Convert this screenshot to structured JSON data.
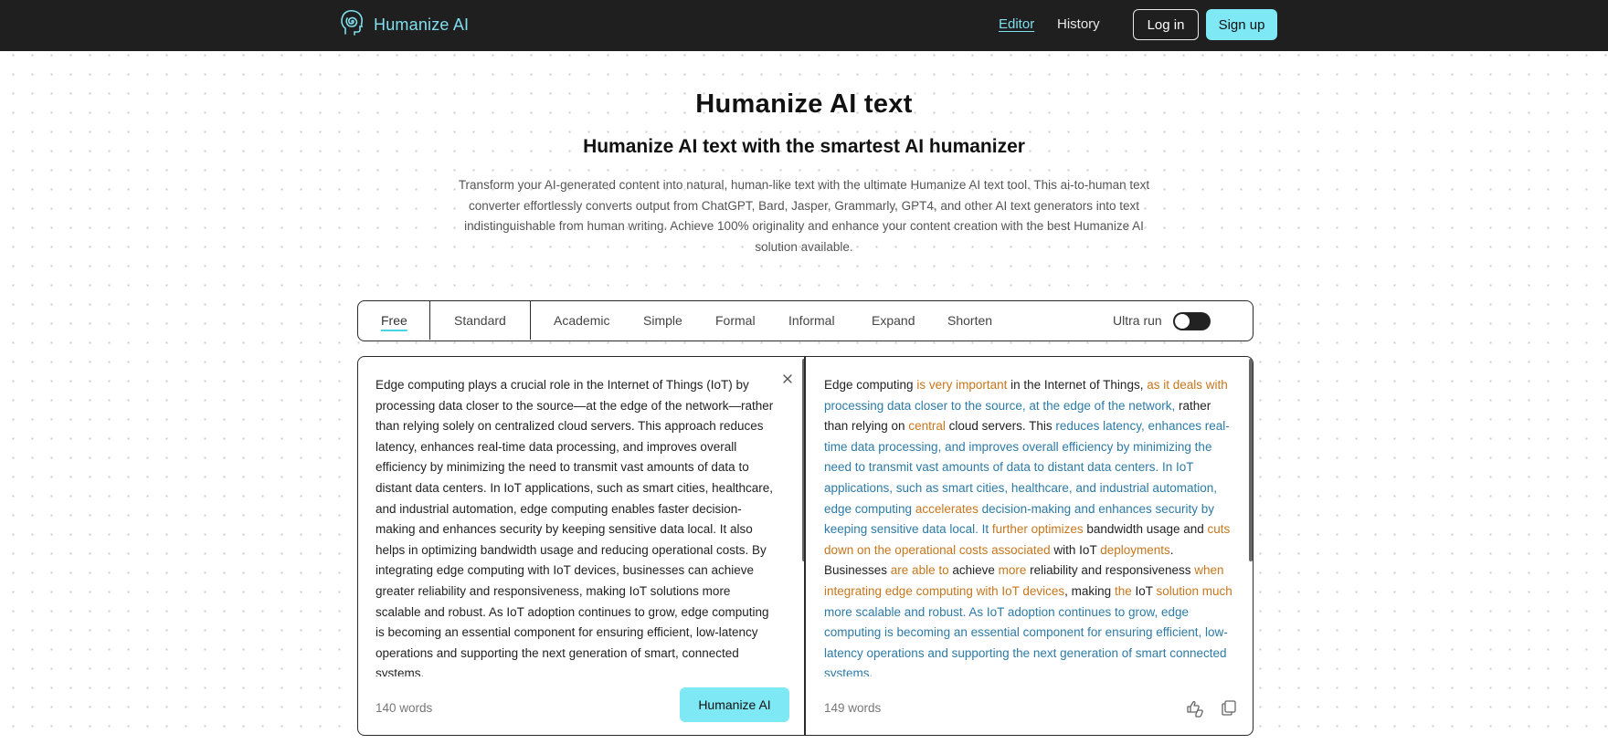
{
  "header": {
    "brand_name": "Humanize AI",
    "logo_icon": "head-spiral-icon",
    "nav": {
      "editor": "Editor",
      "history": "History"
    },
    "login_label": "Log in",
    "signup_label": "Sign up"
  },
  "hero": {
    "title": "Humanize AI text",
    "subtitle": "Humanize AI text with the smartest AI humanizer",
    "description": "Transform your AI-generated content into natural, human-like text with the ultimate Humanize AI text tool. This ai-to-human text converter effortlessly converts output from ChatGPT, Bard, Jasper, Grammarly, GPT4, and other AI text generators into text indistinguishable from human writing. Achieve 100% originality and enhance your content creation with the best Humanize AI solution available."
  },
  "modes": {
    "items": [
      "Free",
      "Standard",
      "Academic",
      "Simple",
      "Formal",
      "Informal",
      "Expand",
      "Shorten"
    ],
    "active": "Free",
    "ultra_label": "Ultra run",
    "ultra_on": false
  },
  "input": {
    "text": "Edge computing plays a crucial role in the Internet of Things (IoT) by processing data closer to the source—at the edge of the network—rather than relying solely on centralized cloud servers. This approach reduces latency, enhances real-time data processing, and improves overall efficiency by minimizing the need to transmit vast amounts of data to distant data centers. In IoT applications, such as smart cities, healthcare, and industrial automation, edge computing enables faster decision-making and enhances security by keeping sensitive data local. It also helps in optimizing bandwidth usage and reducing operational costs. By integrating edge computing with IoT devices, businesses can achieve greater reliability and responsiveness, making IoT solutions more scalable and robust. As IoT adoption continues to grow, edge computing is becoming an essential component for ensuring efficient, low-latency operations and supporting the next generation of smart, connected systems.",
    "word_count": "140 words",
    "humanize_label": "Humanize AI"
  },
  "output": {
    "segments": [
      {
        "t": "Edge computing ",
        "k": "plain"
      },
      {
        "t": "is very important",
        "k": "changed"
      },
      {
        "t": " in the Internet of Things, ",
        "k": "plain"
      },
      {
        "t": "as it deals with",
        "k": "changed"
      },
      {
        "t": " processing data closer to the source, at the edge of the network,",
        "k": "kept"
      },
      {
        "t": " rather than relying on ",
        "k": "plain"
      },
      {
        "t": "central",
        "k": "changed"
      },
      {
        "t": " cloud servers. This ",
        "k": "plain"
      },
      {
        "t": "reduces latency, enhances real-time data processing, and improves overall efficiency by minimizing the need to transmit vast amounts of data to distant data centers. In IoT applications, such as smart cities, healthcare, and industrial automation, edge computing",
        "k": "kept"
      },
      {
        "t": " accelerates",
        "k": "changed"
      },
      {
        "t": " decision-making and enhances security by keeping sensitive data local. It",
        "k": "kept"
      },
      {
        "t": " further optimizes",
        "k": "changed"
      },
      {
        "t": " bandwidth usage and ",
        "k": "plain"
      },
      {
        "t": "cuts down on the operational costs associated",
        "k": "changed"
      },
      {
        "t": " with IoT ",
        "k": "plain"
      },
      {
        "t": "deployments",
        "k": "changed"
      },
      {
        "t": ". Businesses ",
        "k": "plain"
      },
      {
        "t": "are able to",
        "k": "changed"
      },
      {
        "t": " achieve ",
        "k": "plain"
      },
      {
        "t": "more",
        "k": "changed"
      },
      {
        "t": " reliability and responsiveness ",
        "k": "plain"
      },
      {
        "t": "when integrating edge computing with IoT devices",
        "k": "changed"
      },
      {
        "t": ", making ",
        "k": "plain"
      },
      {
        "t": "the",
        "k": "changed"
      },
      {
        "t": " IoT ",
        "k": "plain"
      },
      {
        "t": "solution much",
        "k": "changed"
      },
      {
        "t": " more scalable and robust. As IoT adoption continues to grow, edge computing is becoming an essential component for ensuring efficient, low-latency operations and supporting the next generation of smart connected systems.",
        "k": "kept"
      }
    ],
    "word_count": "149 words",
    "feedback_icon": "thumbs-feedback-icon",
    "copy_icon": "copy-icon"
  },
  "colors": {
    "accent": "#7fe8f5",
    "topbar": "#1f1f1f",
    "changed_text": "#c7761c",
    "kept_text": "#2c7aa6"
  }
}
